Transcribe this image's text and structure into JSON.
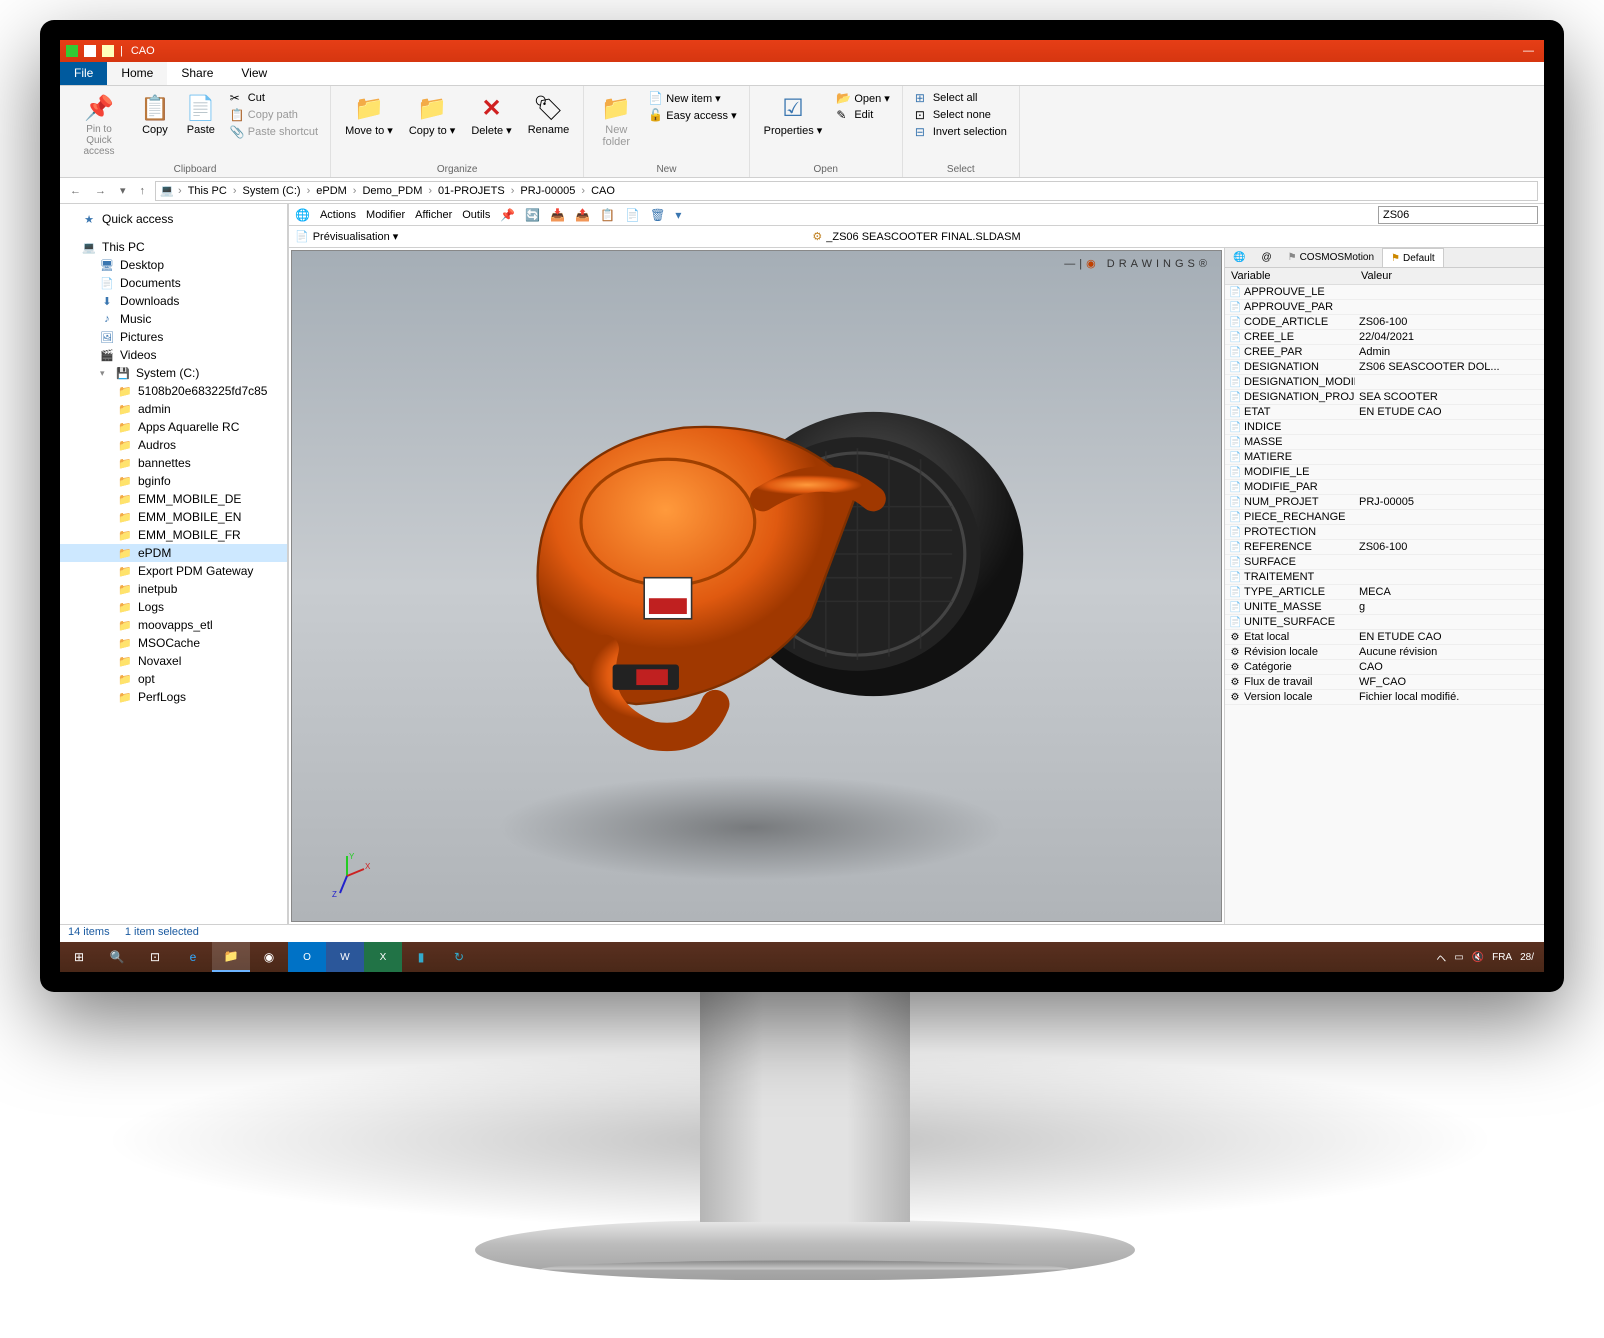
{
  "window": {
    "title": "CAO"
  },
  "ribbon": {
    "tabs": {
      "file": "File",
      "home": "Home",
      "share": "Share",
      "view": "View"
    },
    "clipboard": {
      "pin": "Pin to Quick access",
      "copy": "Copy",
      "paste": "Paste",
      "cut": "Cut",
      "copypath": "Copy path",
      "shortcut": "Paste shortcut",
      "label": "Clipboard"
    },
    "organize": {
      "moveto": "Move to",
      "copyto": "Copy to",
      "delete": "Delete",
      "rename": "Rename",
      "label": "Organize"
    },
    "new": {
      "folder": "New folder",
      "item": "New item",
      "easy": "Easy access",
      "label": "New"
    },
    "open": {
      "props": "Properties",
      "open": "Open",
      "edit": "Edit",
      "label": "Open"
    },
    "select": {
      "all": "Select all",
      "none": "Select none",
      "invert": "Invert selection",
      "label": "Select"
    }
  },
  "breadcrumb": [
    "This PC",
    "System (C:)",
    "ePDM",
    "Demo_PDM",
    "01-PROJETS",
    "PRJ-00005",
    "CAO"
  ],
  "nav": {
    "quick": "Quick access",
    "thispc": "This PC",
    "items": [
      "Desktop",
      "Documents",
      "Downloads",
      "Music",
      "Pictures",
      "Videos"
    ],
    "system": "System (C:)",
    "folders": [
      "5108b20e683225fd7c85",
      "admin",
      "Apps Aquarelle RC",
      "Audros",
      "bannettes",
      "bginfo",
      "EMM_MOBILE_DE",
      "EMM_MOBILE_EN",
      "EMM_MOBILE_FR",
      "ePDM",
      "Export PDM Gateway",
      "inetpub",
      "Logs",
      "moovapps_etl",
      "MSOCache",
      "Novaxel",
      "opt",
      "PerfLogs"
    ]
  },
  "toolbar": {
    "actions": "Actions",
    "modifier": "Modifier",
    "afficher": "Afficher",
    "outils": "Outils",
    "search": "ZS06"
  },
  "preview": {
    "label": "Prévisualisation",
    "filename": "_ZS06 SEASCOOTER FINAL.SLDASM",
    "logo": "DRAWINGS®"
  },
  "props": {
    "tabs": {
      "cosmos": "COSMOSMotion",
      "default": "Default"
    },
    "headers": {
      "var": "Variable",
      "val": "Valeur"
    },
    "rows": [
      {
        "icon": "📄",
        "var": "APPROUVE_LE",
        "val": ""
      },
      {
        "icon": "📄",
        "var": "APPROUVE_PAR",
        "val": ""
      },
      {
        "icon": "📄",
        "var": "CODE_ARTICLE",
        "val": "ZS06-100"
      },
      {
        "icon": "📄",
        "var": "CREE_LE",
        "val": "22/04/2021"
      },
      {
        "icon": "📄",
        "var": "CREE_PAR",
        "val": "Admin"
      },
      {
        "icon": "📄",
        "var": "DESIGNATION",
        "val": "ZS06 SEASCOOTER  DOL..."
      },
      {
        "icon": "📄",
        "var": "DESIGNATION_MODIF",
        "val": ""
      },
      {
        "icon": "📄",
        "var": "DESIGNATION_PROJET",
        "val": "SEA SCOOTER"
      },
      {
        "icon": "📄",
        "var": "ETAT",
        "val": "EN ETUDE CAO"
      },
      {
        "icon": "📄",
        "var": "INDICE",
        "val": ""
      },
      {
        "icon": "📄",
        "var": "MASSE",
        "val": ""
      },
      {
        "icon": "📄",
        "var": "MATIERE",
        "val": ""
      },
      {
        "icon": "📄",
        "var": "MODIFIE_LE",
        "val": ""
      },
      {
        "icon": "📄",
        "var": "MODIFIE_PAR",
        "val": ""
      },
      {
        "icon": "📄",
        "var": "NUM_PROJET",
        "val": "PRJ-00005"
      },
      {
        "icon": "📄",
        "var": "PIECE_RECHANGE",
        "val": ""
      },
      {
        "icon": "📄",
        "var": "PROTECTION",
        "val": ""
      },
      {
        "icon": "📄",
        "var": "REFERENCE",
        "val": "ZS06-100"
      },
      {
        "icon": "📄",
        "var": "SURFACE",
        "val": ""
      },
      {
        "icon": "📄",
        "var": "TRAITEMENT",
        "val": ""
      },
      {
        "icon": "📄",
        "var": "TYPE_ARTICLE",
        "val": "MECA"
      },
      {
        "icon": "📄",
        "var": "UNITE_MASSE",
        "val": "g"
      },
      {
        "icon": "📄",
        "var": "UNITE_SURFACE",
        "val": ""
      },
      {
        "icon": "⚙",
        "var": "Etat local",
        "val": "EN ETUDE CAO"
      },
      {
        "icon": "⚙",
        "var": "Révision locale",
        "val": "Aucune révision"
      },
      {
        "icon": "⚙",
        "var": "Catégorie",
        "val": "CAO"
      },
      {
        "icon": "⚙",
        "var": "Flux de travail",
        "val": "WF_CAO"
      },
      {
        "icon": "⚙",
        "var": "Version locale",
        "val": "Fichier local modifié."
      }
    ]
  },
  "status": {
    "items": "14 items",
    "selected": "1 item selected"
  },
  "taskbar": {
    "lang": "FRA",
    "clock": "28/"
  }
}
